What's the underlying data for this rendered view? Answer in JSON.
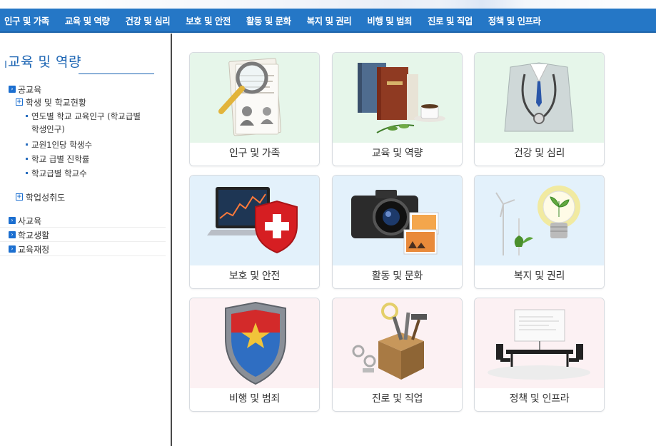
{
  "nav": {
    "items": [
      "인구 및 가족",
      "교육 및 역량",
      "건강 및 심리",
      "보호 및 안전",
      "활동 및 문화",
      "복지 및 권리",
      "비행 및 범죄",
      "진로 및 직업",
      "정책 및 인프라"
    ]
  },
  "sidebar": {
    "title": "교육 및 역량",
    "menu": {
      "public_edu": "공교육",
      "students_status": "학생 및 학교현황",
      "sub1_line1": "연도별 학교 교육인구 (학교급별",
      "sub1_line2": "학생인구)",
      "sub2": "교원1인당 학생수",
      "sub3": "학교 급별 진학률",
      "sub4": "학교급별 학교수",
      "achievement": "학업성취도",
      "private_edu": "사교육",
      "school_life": "학교생활",
      "edu_finance": "교육재정"
    },
    "colors": {
      "title": "#1b64b3",
      "arrow_box": "#1c6fd0"
    }
  },
  "cards": [
    {
      "label": "인구 및 가족",
      "icon": "magnifier-document-icon"
    },
    {
      "label": "교육 및 역량",
      "icon": "books-coffee-icon"
    },
    {
      "label": "건강 및 심리",
      "icon": "doctor-stethoscope-icon"
    },
    {
      "label": "보호 및 안전",
      "icon": "laptop-shield-icon"
    },
    {
      "label": "활동 및 문화",
      "icon": "camera-photos-icon"
    },
    {
      "label": "복지 및 권리",
      "icon": "lightbulb-sprout-icon"
    },
    {
      "label": "비행 및 범죄",
      "icon": "police-shield-icon"
    },
    {
      "label": "진로 및 직업",
      "icon": "toolbox-icon"
    },
    {
      "label": "정책 및 인프라",
      "icon": "meeting-board-icon"
    }
  ],
  "colors": {
    "nav_bg": "#2577c6",
    "row1_bg": "#e6f6ea",
    "row2_bg": "#e3f1fb",
    "row3_bg": "#fcf1f3"
  }
}
